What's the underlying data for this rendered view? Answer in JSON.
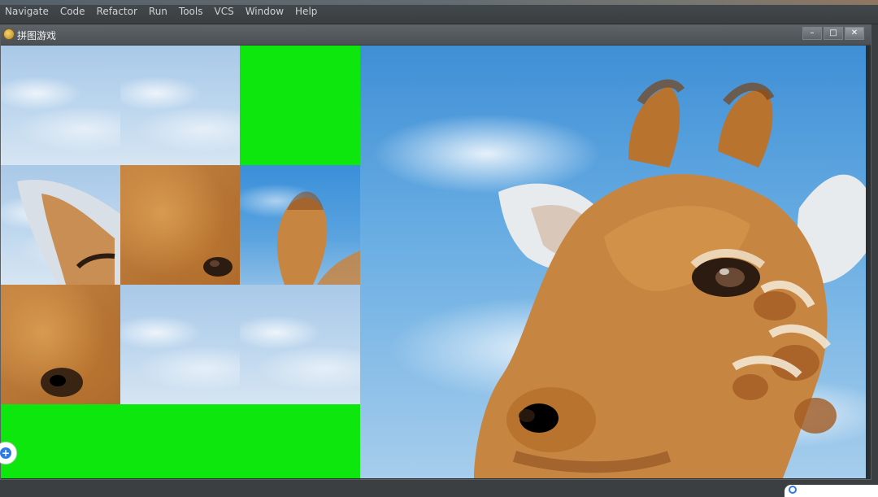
{
  "ide": {
    "menu": [
      {
        "label": "Navigate",
        "u": "N"
      },
      {
        "label": "Code",
        "u": "C"
      },
      {
        "label": "Refactor",
        "u": "R"
      },
      {
        "label": "Run",
        "u": "u"
      },
      {
        "label": "Tools",
        "u": "T"
      },
      {
        "label": "VCS",
        "u": "S"
      },
      {
        "label": "Window",
        "u": "W"
      },
      {
        "label": "Help",
        "u": "H"
      }
    ]
  },
  "window": {
    "title": "拼图游戏",
    "controls": {
      "minimize": "–",
      "maximize": "□",
      "close": "✕"
    }
  },
  "colors": {
    "empty_tile": "#0ee70e",
    "sky": "#4a9bdc",
    "giraffe_fur": "#c78542"
  },
  "icons": {
    "app": "giraffe-app-icon",
    "float": "plus-circle-icon",
    "search": "search-icon"
  }
}
